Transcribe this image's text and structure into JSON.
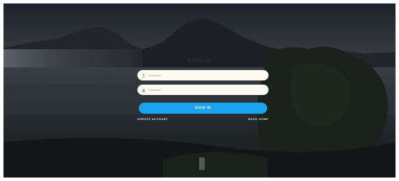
{
  "form": {
    "title": "SIGN-IN",
    "username_placeholder": "Username",
    "password_placeholder": "Password",
    "submit_label": "SIGN IN",
    "create_account_label": "CREATE ACCOUNT",
    "back_home_label": "BACK HOME"
  },
  "icons": {
    "username": "user-icon",
    "password": "lock-icon"
  },
  "colors": {
    "accent": "#1aa3f0",
    "field_background": "#fbfbf2",
    "link_text": "#e8ecf0"
  }
}
